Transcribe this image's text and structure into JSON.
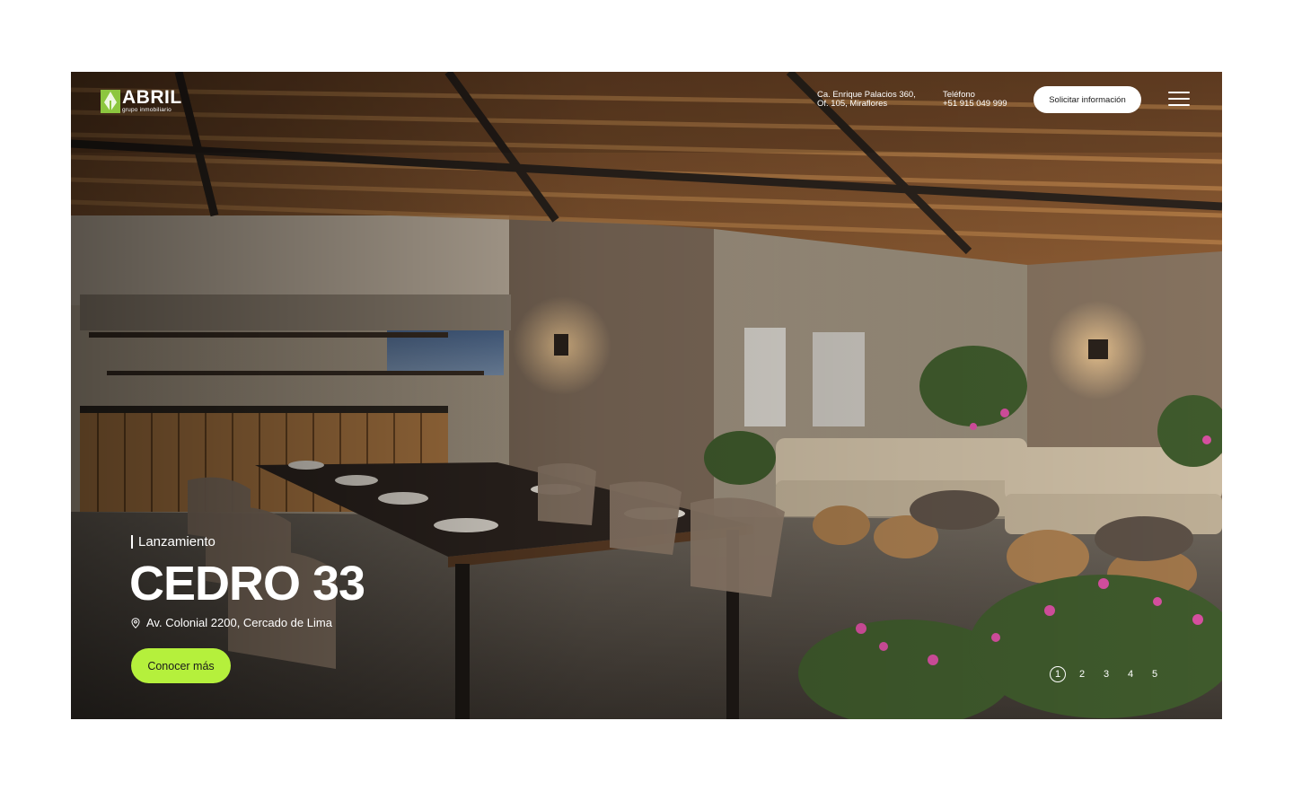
{
  "header": {
    "logo_word": "ABRIL",
    "logo_tagline": "grupo inmobiliario",
    "address_line1": "Ca. Enrique Palacios 360,",
    "address_line2": "Of. 105, Miraflores",
    "phone_label": "Teléfono",
    "phone_number": "+51 915 049 999",
    "cta_label": "Solicitar información",
    "menu_icon": "hamburger-menu-icon"
  },
  "hero": {
    "tag": "Lanzamiento",
    "title": "CEDRO 33",
    "address": "Av. Colonial 2200, Cercado de Lima",
    "location_icon": "location-pin-icon",
    "cta_label": "Conocer más",
    "image_subject": "rooftop lounge with pergola, dining table and sofas"
  },
  "pagination": {
    "pages": [
      "1",
      "2",
      "3",
      "4",
      "5"
    ],
    "active": 1
  },
  "colors": {
    "accent": "#b5f03c",
    "brand_green": "#8cc63f",
    "text_light": "#ffffff"
  }
}
